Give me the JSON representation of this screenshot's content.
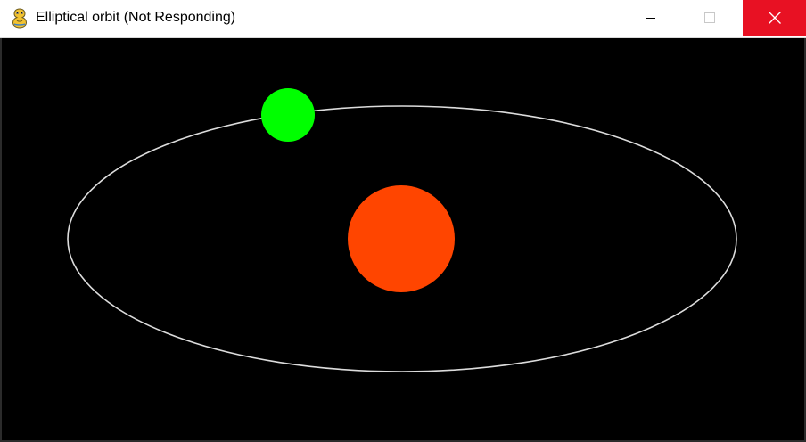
{
  "window": {
    "title": "Elliptical orbit (Not Responding)",
    "icon": "pygame-snake-icon",
    "controls": {
      "minimize_icon": "minimize-icon",
      "maximize_icon": "maximize-icon",
      "close_icon": "close-icon",
      "close_color": "#e81123"
    }
  },
  "scene": {
    "background_color": "#000000",
    "orbit": {
      "stroke_color": "#dcdcdc"
    },
    "sun": {
      "color": "#ff4500"
    },
    "planet": {
      "color": "#00ff00"
    }
  }
}
